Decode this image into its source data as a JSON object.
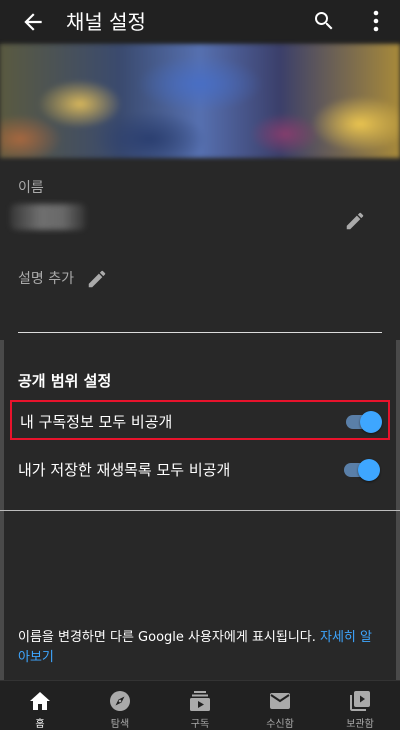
{
  "appbar": {
    "title": "채널 설정",
    "back_icon": "arrow-left-icon",
    "search_icon": "search-icon",
    "more_icon": "more-vert-icon"
  },
  "profile": {
    "name_label": "이름",
    "description_label": "설명 추가",
    "edit_icon": "pencil-icon"
  },
  "privacy": {
    "section_title": "공개 범위 설정",
    "settings": [
      {
        "label": "내 구독정보 모두 비공개",
        "enabled": true,
        "highlighted": true
      },
      {
        "label": "내가 저장한 재생목록 모두 비공개",
        "enabled": true,
        "highlighted": false
      }
    ],
    "accent_color": "#3ea6ff",
    "highlight_color": "#e8132c"
  },
  "footer": {
    "note": "이름을 변경하면 다른 Google 사용자에게 표시됩니다. ",
    "link": "자세히 알아보기"
  },
  "bottom_nav": {
    "items": [
      {
        "label": "홈",
        "icon": "home-icon",
        "active": true
      },
      {
        "label": "탐색",
        "icon": "explore-icon",
        "active": false
      },
      {
        "label": "구독",
        "icon": "subscriptions-icon",
        "active": false
      },
      {
        "label": "수신함",
        "icon": "inbox-icon",
        "active": false
      },
      {
        "label": "보관함",
        "icon": "library-icon",
        "active": false
      }
    ]
  }
}
